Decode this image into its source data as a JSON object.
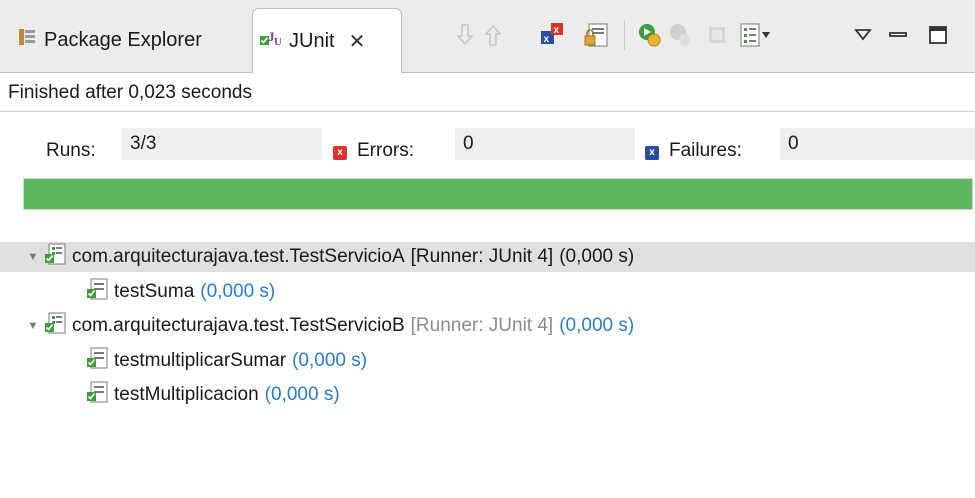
{
  "tabs": [
    {
      "label": "Package Explorer",
      "active": false,
      "icon": "package-explorer-icon"
    },
    {
      "label": "JUnit",
      "active": true,
      "icon": "junit-icon"
    }
  ],
  "toolbar": {
    "icons": [
      "next-failure-icon",
      "previous-failure-icon",
      "show-failures-only-icon",
      "scroll-lock-icon",
      "rerun-test-icon",
      "rerun-failed-first-icon",
      "stop-icon",
      "test-run-history-icon",
      "view-menu-icon",
      "minimize-icon",
      "maximize-icon"
    ]
  },
  "status": {
    "text": "Finished after 0,023 seconds"
  },
  "counters": {
    "runs_label": "Runs:",
    "runs_value": "3/3",
    "errors_label": "Errors:",
    "errors_value": "0",
    "failures_label": "Failures:",
    "failures_value": "0"
  },
  "progress": {
    "fraction": 1.0,
    "color": "#5cb85c"
  },
  "tree": [
    {
      "label": "com.arquitecturajava.test.TestServicioA",
      "runner": "[Runner: JUnit 4]",
      "time": "(0,000 s)",
      "type": "suite",
      "expanded": true,
      "selected": true
    },
    {
      "label": "testSuma",
      "time": "(0,000 s)",
      "type": "test"
    },
    {
      "label": "com.arquitecturajava.test.TestServicioB",
      "runner": "[Runner: JUnit 4]",
      "time": "(0,000 s)",
      "type": "suite",
      "expanded": true,
      "selected": false
    },
    {
      "label": "testmultiplicarSumar",
      "time": "(0,000 s)",
      "type": "test"
    },
    {
      "label": "testMultiplicacion",
      "time": "(0,000 s)",
      "type": "test"
    }
  ],
  "colors": {
    "time": "#2a7cc7",
    "runner": "#8d8d8d",
    "error": "#d9332b",
    "failure": "#2b4f9c",
    "selection": "#e0e0e0"
  }
}
